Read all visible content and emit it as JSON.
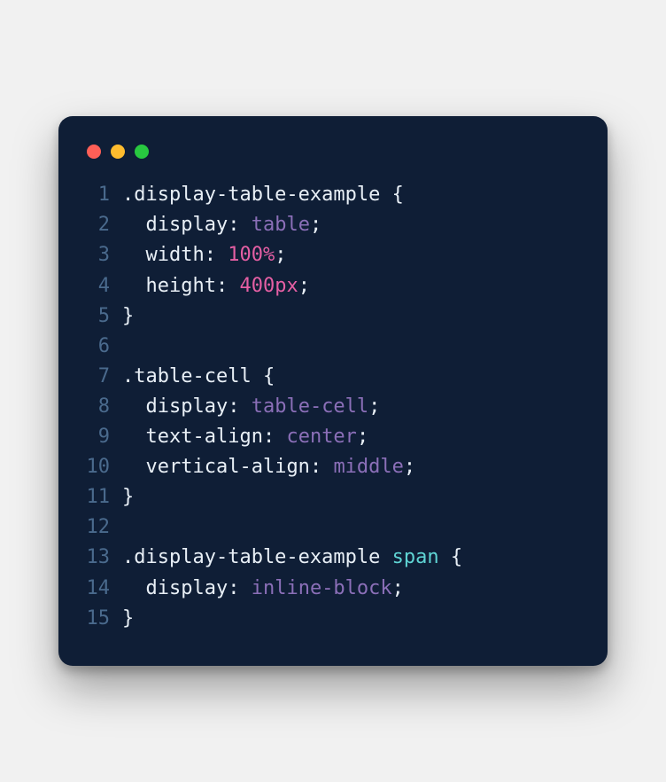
{
  "window": {
    "traffic_lights": {
      "red": "#ff5f57",
      "yellow": "#febc2e",
      "green": "#28c840"
    }
  },
  "code": {
    "lines": [
      {
        "n": "1",
        "tokens": [
          {
            "t": ".display-table-example ",
            "c": "selector"
          },
          {
            "t": "{",
            "c": "brace"
          }
        ]
      },
      {
        "n": "2",
        "tokens": [
          {
            "t": "  ",
            "c": "content"
          },
          {
            "t": "display",
            "c": "property"
          },
          {
            "t": ": ",
            "c": "colon"
          },
          {
            "t": "table",
            "c": "val-keyword"
          },
          {
            "t": ";",
            "c": "semi"
          }
        ]
      },
      {
        "n": "3",
        "tokens": [
          {
            "t": "  ",
            "c": "content"
          },
          {
            "t": "width",
            "c": "property"
          },
          {
            "t": ": ",
            "c": "colon"
          },
          {
            "t": "100%",
            "c": "val-number"
          },
          {
            "t": ";",
            "c": "semi"
          }
        ]
      },
      {
        "n": "4",
        "tokens": [
          {
            "t": "  ",
            "c": "content"
          },
          {
            "t": "height",
            "c": "property"
          },
          {
            "t": ": ",
            "c": "colon"
          },
          {
            "t": "400px",
            "c": "val-number"
          },
          {
            "t": ";",
            "c": "semi"
          }
        ]
      },
      {
        "n": "5",
        "tokens": [
          {
            "t": "}",
            "c": "brace"
          }
        ]
      },
      {
        "n": "6",
        "tokens": [
          {
            "t": "",
            "c": "content"
          }
        ]
      },
      {
        "n": "7",
        "tokens": [
          {
            "t": ".table-cell ",
            "c": "selector"
          },
          {
            "t": "{",
            "c": "brace"
          }
        ]
      },
      {
        "n": "8",
        "tokens": [
          {
            "t": "  ",
            "c": "content"
          },
          {
            "t": "display",
            "c": "property"
          },
          {
            "t": ": ",
            "c": "colon"
          },
          {
            "t": "table-cell",
            "c": "val-keyword"
          },
          {
            "t": ";",
            "c": "semi"
          }
        ]
      },
      {
        "n": "9",
        "tokens": [
          {
            "t": "  ",
            "c": "content"
          },
          {
            "t": "text-align",
            "c": "property"
          },
          {
            "t": ": ",
            "c": "colon"
          },
          {
            "t": "center",
            "c": "val-keyword"
          },
          {
            "t": ";",
            "c": "semi"
          }
        ]
      },
      {
        "n": "10",
        "tokens": [
          {
            "t": "  ",
            "c": "content"
          },
          {
            "t": "vertical-align",
            "c": "property"
          },
          {
            "t": ": ",
            "c": "colon"
          },
          {
            "t": "middle",
            "c": "val-keyword"
          },
          {
            "t": ";",
            "c": "semi"
          }
        ]
      },
      {
        "n": "11",
        "tokens": [
          {
            "t": "}",
            "c": "brace"
          }
        ]
      },
      {
        "n": "12",
        "tokens": [
          {
            "t": "",
            "c": "content"
          }
        ]
      },
      {
        "n": "13",
        "tokens": [
          {
            "t": ".display-table-example ",
            "c": "selector"
          },
          {
            "t": "span",
            "c": "tag"
          },
          {
            "t": " ",
            "c": "selector"
          },
          {
            "t": "{",
            "c": "brace"
          }
        ]
      },
      {
        "n": "14",
        "tokens": [
          {
            "t": "  ",
            "c": "content"
          },
          {
            "t": "display",
            "c": "property"
          },
          {
            "t": ": ",
            "c": "colon"
          },
          {
            "t": "inline-block",
            "c": "val-keyword"
          },
          {
            "t": ";",
            "c": "semi"
          }
        ]
      },
      {
        "n": "15",
        "tokens": [
          {
            "t": "}",
            "c": "brace"
          }
        ]
      }
    ]
  }
}
